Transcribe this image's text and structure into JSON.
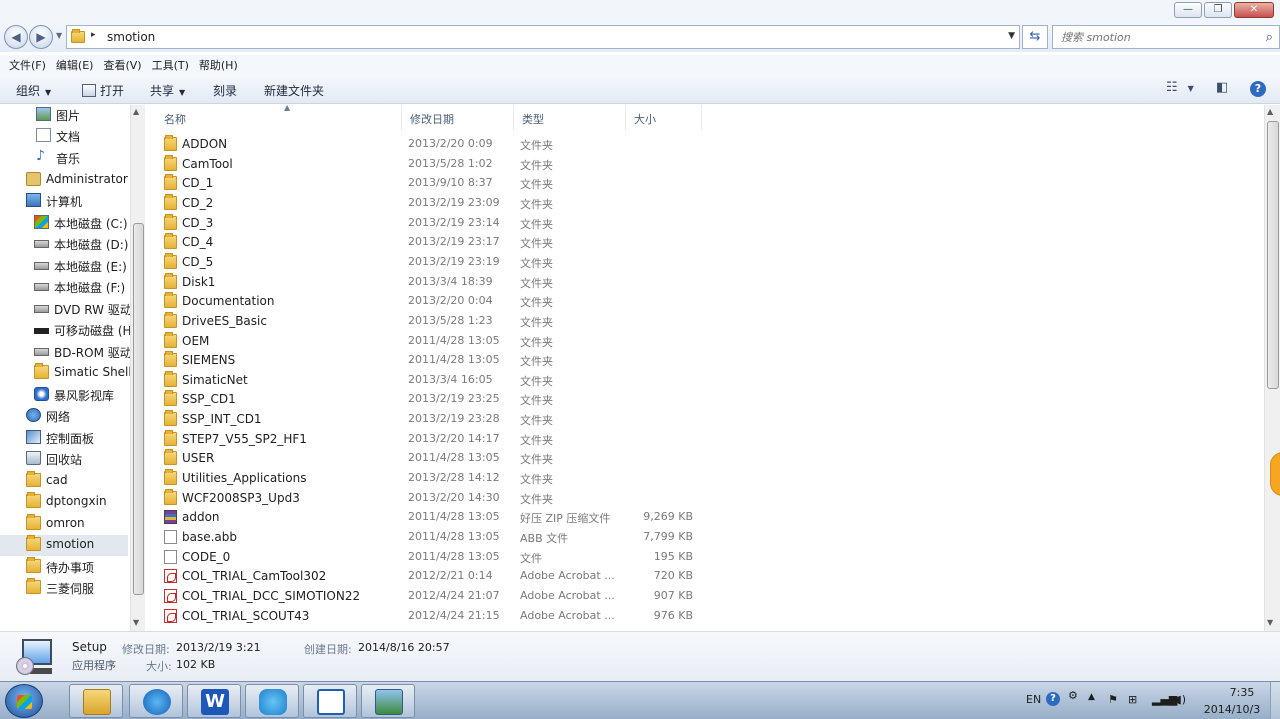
{
  "window": {
    "minimize_glyph": "—",
    "maximize_glyph": "❐",
    "close_glyph": "✕"
  },
  "address": {
    "path": "smotion",
    "separator": "▸",
    "search_placeholder": "搜索 smotion"
  },
  "menu": [
    "文件(F)",
    "编辑(E)",
    "查看(V)",
    "工具(T)",
    "帮助(H)"
  ],
  "toolbar": {
    "organize": "组织",
    "open": "打开",
    "share": "共享",
    "burn": "刻录",
    "new_folder": "新建文件夹"
  },
  "nav": [
    {
      "label": "图片",
      "icon": "pictures-icon"
    },
    {
      "label": "文档",
      "icon": "documents-icon"
    },
    {
      "label": "音乐",
      "icon": "music-icon"
    },
    {
      "label": "Administrator",
      "icon": "user-folder-icon"
    },
    {
      "label": "计算机",
      "icon": "computer-icon"
    },
    {
      "label": "本地磁盘 (C:)",
      "icon": "system-drive-icon"
    },
    {
      "label": "本地磁盘 (D:)",
      "icon": "drive-icon"
    },
    {
      "label": "本地磁盘 (E:)",
      "icon": "drive-icon"
    },
    {
      "label": "本地磁盘 (F:)",
      "icon": "drive-icon"
    },
    {
      "label": "DVD RW 驱动",
      "icon": "dvd-drive-icon"
    },
    {
      "label": "可移动磁盘 (H",
      "icon": "removable-drive-icon"
    },
    {
      "label": "BD-ROM 驱动",
      "icon": "bd-drive-icon"
    },
    {
      "label": "Simatic Shell",
      "icon": "folder-icon"
    },
    {
      "label": "暴风影视库",
      "icon": "storm-library-icon"
    },
    {
      "label": "网络",
      "icon": "network-icon"
    },
    {
      "label": "控制面板",
      "icon": "control-panel-icon"
    },
    {
      "label": "回收站",
      "icon": "recycle-bin-icon"
    },
    {
      "label": "cad",
      "icon": "folder-icon"
    },
    {
      "label": "dptongxin",
      "icon": "folder-icon"
    },
    {
      "label": "omron",
      "icon": "folder-icon"
    },
    {
      "label": "smotion",
      "icon": "folder-icon",
      "selected": true
    },
    {
      "label": "待办事项",
      "icon": "folder-icon"
    },
    {
      "label": "三菱伺服",
      "icon": "folder-icon"
    }
  ],
  "columns": {
    "name": "名称",
    "date": "修改日期",
    "type": "类型",
    "size": "大小"
  },
  "files": [
    {
      "name": "ADDON",
      "date": "2013/2/20 0:09",
      "type": "文件夹",
      "size": "",
      "icon": "folder-icon"
    },
    {
      "name": "CamTool",
      "date": "2013/5/28 1:02",
      "type": "文件夹",
      "size": "",
      "icon": "folder-icon"
    },
    {
      "name": "CD_1",
      "date": "2013/9/10 8:37",
      "type": "文件夹",
      "size": "",
      "icon": "folder-icon"
    },
    {
      "name": "CD_2",
      "date": "2013/2/19 23:09",
      "type": "文件夹",
      "size": "",
      "icon": "folder-icon"
    },
    {
      "name": "CD_3",
      "date": "2013/2/19 23:14",
      "type": "文件夹",
      "size": "",
      "icon": "folder-icon"
    },
    {
      "name": "CD_4",
      "date": "2013/2/19 23:17",
      "type": "文件夹",
      "size": "",
      "icon": "folder-icon"
    },
    {
      "name": "CD_5",
      "date": "2013/2/19 23:19",
      "type": "文件夹",
      "size": "",
      "icon": "folder-icon"
    },
    {
      "name": "Disk1",
      "date": "2013/3/4 18:39",
      "type": "文件夹",
      "size": "",
      "icon": "folder-icon"
    },
    {
      "name": "Documentation",
      "date": "2013/2/20 0:04",
      "type": "文件夹",
      "size": "",
      "icon": "folder-icon"
    },
    {
      "name": "DriveES_Basic",
      "date": "2013/5/28 1:23",
      "type": "文件夹",
      "size": "",
      "icon": "folder-icon"
    },
    {
      "name": "OEM",
      "date": "2011/4/28 13:05",
      "type": "文件夹",
      "size": "",
      "icon": "folder-icon"
    },
    {
      "name": "SIEMENS",
      "date": "2011/4/28 13:05",
      "type": "文件夹",
      "size": "",
      "icon": "folder-icon"
    },
    {
      "name": "SimaticNet",
      "date": "2013/3/4 16:05",
      "type": "文件夹",
      "size": "",
      "icon": "folder-icon"
    },
    {
      "name": "SSP_CD1",
      "date": "2013/2/19 23:25",
      "type": "文件夹",
      "size": "",
      "icon": "folder-icon"
    },
    {
      "name": "SSP_INT_CD1",
      "date": "2013/2/19 23:28",
      "type": "文件夹",
      "size": "",
      "icon": "folder-icon"
    },
    {
      "name": "STEP7_V55_SP2_HF1",
      "date": "2013/2/20 14:17",
      "type": "文件夹",
      "size": "",
      "icon": "folder-icon"
    },
    {
      "name": "USER",
      "date": "2011/4/28 13:05",
      "type": "文件夹",
      "size": "",
      "icon": "folder-icon"
    },
    {
      "name": "Utilities_Applications",
      "date": "2013/2/28 14:12",
      "type": "文件夹",
      "size": "",
      "icon": "folder-icon"
    },
    {
      "name": "WCF2008SP3_Upd3",
      "date": "2013/2/20 14:30",
      "type": "文件夹",
      "size": "",
      "icon": "folder-icon"
    },
    {
      "name": "addon",
      "date": "2011/4/28 13:05",
      "type": "好压 ZIP 压缩文件",
      "size": "9,269 KB",
      "icon": "zip-icon"
    },
    {
      "name": "base.abb",
      "date": "2011/4/28 13:05",
      "type": "ABB 文件",
      "size": "7,799 KB",
      "icon": "file-icon"
    },
    {
      "name": "CODE_0",
      "date": "2011/4/28 13:05",
      "type": "文件",
      "size": "195 KB",
      "icon": "file-icon"
    },
    {
      "name": "COL_TRIAL_CamTool302",
      "date": "2012/2/21 0:14",
      "type": "Adobe Acrobat ...",
      "size": "720 KB",
      "icon": "pdf-icon"
    },
    {
      "name": "COL_TRIAL_DCC_SIMOTION22",
      "date": "2012/4/24 21:07",
      "type": "Adobe Acrobat ...",
      "size": "907 KB",
      "icon": "pdf-icon"
    },
    {
      "name": "COL_TRIAL_SCOUT43",
      "date": "2012/4/24 21:15",
      "type": "Adobe Acrobat ...",
      "size": "976 KB",
      "icon": "pdf-icon"
    }
  ],
  "details": {
    "name": "Setup",
    "type": "应用程序",
    "modified_label": "修改日期:",
    "modified_value": "2013/2/19 3:21",
    "created_label": "创建日期:",
    "created_value": "2014/8/16 20:57",
    "size_label": "大小:",
    "size_value": "102 KB"
  },
  "taskbar": {
    "apps": [
      "file-explorer-icon",
      "browser-icon",
      "wps-writer-icon",
      "chat-app-icon",
      "simotion-scout-icon",
      "image-viewer-icon"
    ],
    "lang": "EN",
    "time": "7:35",
    "date": "2014/10/3"
  },
  "colors": {
    "selected_nav": "#e3e8ef",
    "accent": "#2d6bc3",
    "folder": "#e6b236"
  }
}
